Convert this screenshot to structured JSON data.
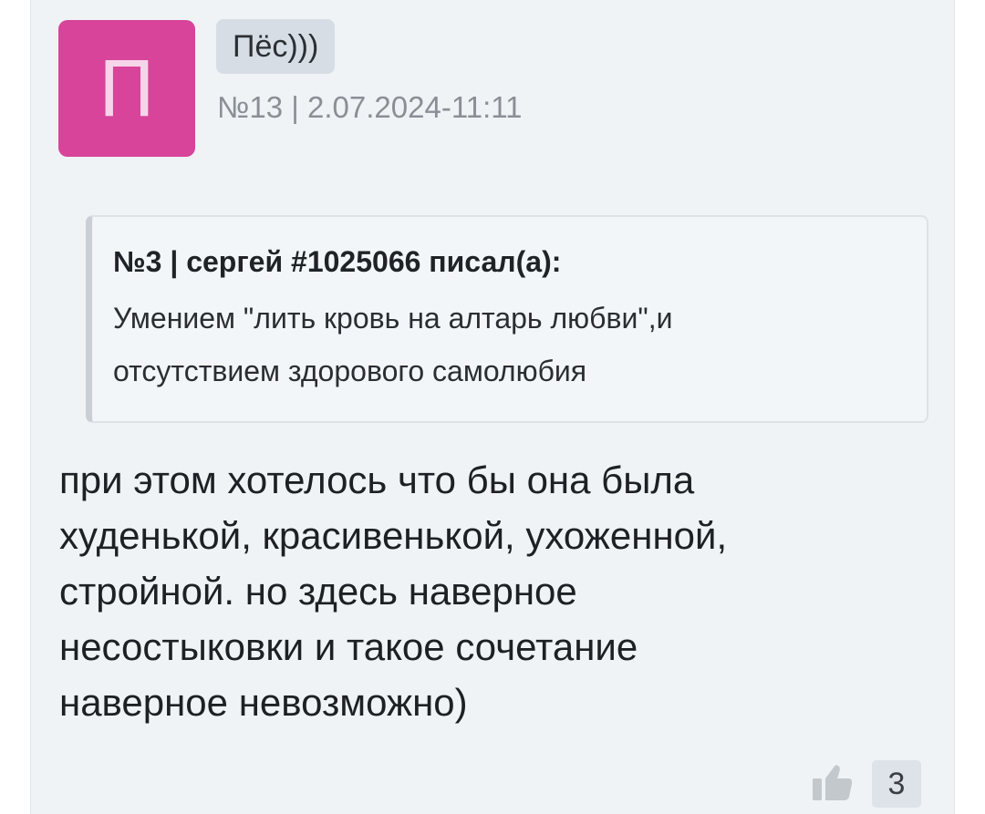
{
  "post": {
    "avatar_letter": "П",
    "avatar_color": "#d7449a",
    "author": "Пёс)))",
    "meta": "№13 | 2.07.2024-11:11"
  },
  "quote": {
    "header": "№3 | сергей #1025066 писал(а):",
    "line1": "Умением \"лить кровь на алтарь любви\",и",
    "line2": "отсутствием здорового самолюбия"
  },
  "message": {
    "lines": [
      "при этом хотелось что бы она была",
      "худенькой, красивенькой, ухоженной,",
      "стройной. но здесь наверное",
      "несостыковки и такое сочетание",
      "наверное невозможно)"
    ]
  },
  "reactions": {
    "like_icon": "thumbs-up-icon",
    "like_count": "3"
  }
}
